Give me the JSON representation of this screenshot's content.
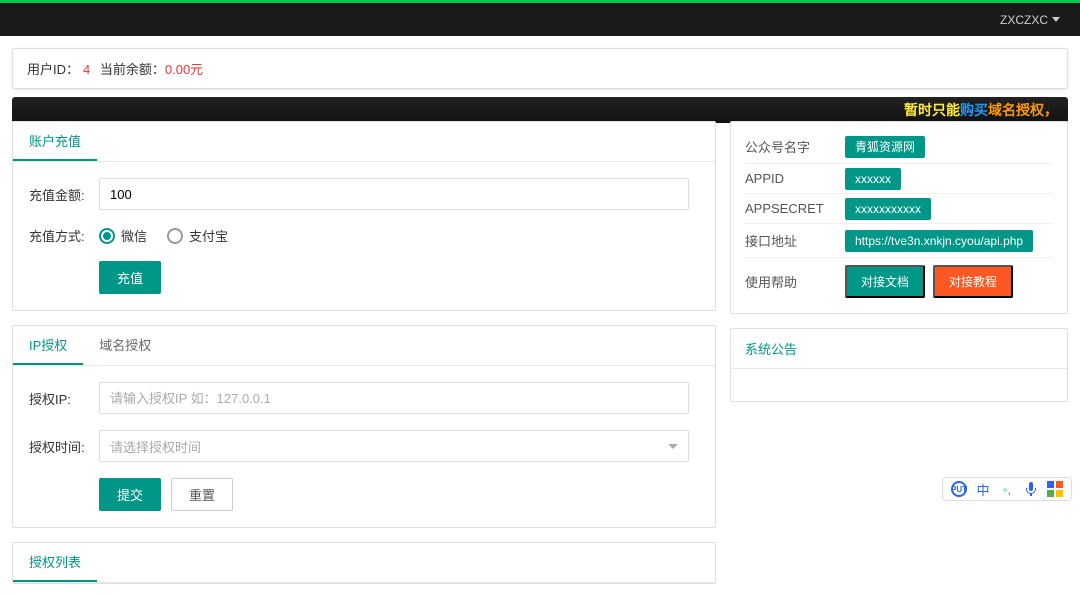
{
  "header": {
    "username": "ZXCZXC"
  },
  "info": {
    "uid_label": "用户ID：",
    "uid_value": "4",
    "balance_label": " 当前余额：",
    "balance_value": "0.00元"
  },
  "marquee": {
    "seg1": "暂时只能",
    "seg2": "购买",
    "seg3": "域名授权，"
  },
  "recharge": {
    "tab_label": "账户充值",
    "amount_label": "充值金额:",
    "amount_value": "100",
    "method_label": "充值方式:",
    "wechat": "微信",
    "alipay": "支付宝",
    "submit": "充值"
  },
  "auth": {
    "tab_ip": "IP授权",
    "tab_domain": "域名授权",
    "ip_label": "授权IP:",
    "ip_placeholder": "请输入授权IP 如：127.0.0.1",
    "time_label": "授权时间:",
    "time_placeholder": "请选择授权时间",
    "submit": "提交",
    "reset": "重置"
  },
  "auth_list": {
    "tab_label": "授权列表"
  },
  "side_info": {
    "name_label": "公众号名字",
    "name_value": "青狐资源网",
    "appid_label": "APPID",
    "appid_value": "xxxxxx",
    "secret_label": "APPSECRET",
    "secret_value": "xxxxxxxxxxx",
    "api_label": "接口地址",
    "api_value": "https://tve3n.xnkjn.cyou/api.php",
    "help_label": "使用帮助",
    "doc_btn": "对接文档",
    "tutorial_btn": "对接教程"
  },
  "notice": {
    "title": "系统公告"
  }
}
